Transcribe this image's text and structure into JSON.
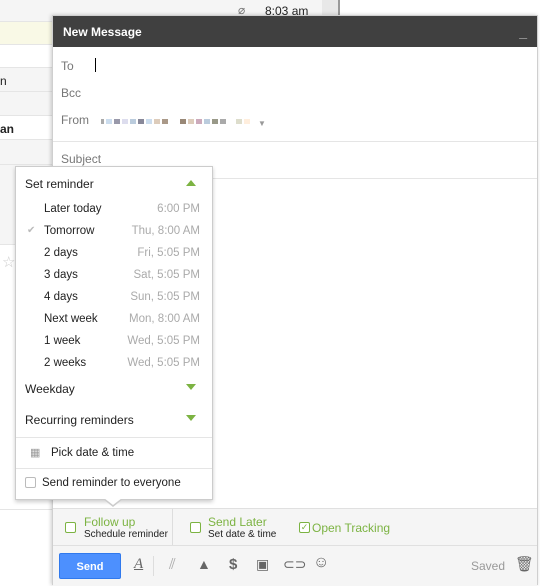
{
  "inbox": {
    "top_time": "8:03 am",
    "row_fragment_1": "n",
    "row_fragment_2": "an"
  },
  "compose": {
    "title": "New Message",
    "minimize": "_",
    "to_label": "To",
    "bcc_label": "Bcc",
    "from_label": "From",
    "subject_label": "Subject",
    "followup_title": "Follow up",
    "followup_sub": "Schedule reminder",
    "sendlater_title": "Send Later",
    "sendlater_sub": "Set date & time",
    "tracking_label": "Open Tracking",
    "tracking_checked": true,
    "send_label": "Send",
    "saved_label": "Saved",
    "accent": "#7cb342",
    "send_color": "#4d90fe"
  },
  "reminder": {
    "header": "Set reminder",
    "items": [
      {
        "label": "Later today",
        "time": "6:00 PM",
        "selected": false
      },
      {
        "label": "Tomorrow",
        "time": "Thu, 8:00 AM",
        "selected": true
      },
      {
        "label": "2 days",
        "time": "Fri, 5:05 PM",
        "selected": false
      },
      {
        "label": "3 days",
        "time": "Sat, 5:05 PM",
        "selected": false
      },
      {
        "label": "4 days",
        "time": "Sun, 5:05 PM",
        "selected": false
      },
      {
        "label": "Next week",
        "time": "Mon, 8:00 AM",
        "selected": false
      },
      {
        "label": "1 week",
        "time": "Wed, 5:05 PM",
        "selected": false
      },
      {
        "label": "2 weeks",
        "time": "Wed, 5:05 PM",
        "selected": false
      }
    ],
    "weekday": "Weekday",
    "recurring": "Recurring reminders",
    "pick": "Pick date & time",
    "everyone": "Send reminder to everyone"
  },
  "icons": [
    "paperclip-icon",
    "formatting-icon",
    "attach-icon",
    "drive-icon",
    "dollar-icon",
    "photo-icon",
    "link-icon",
    "emoji-icon",
    "trash-icon",
    "calendar-icon",
    "star-icon",
    "checkmark-icon"
  ]
}
